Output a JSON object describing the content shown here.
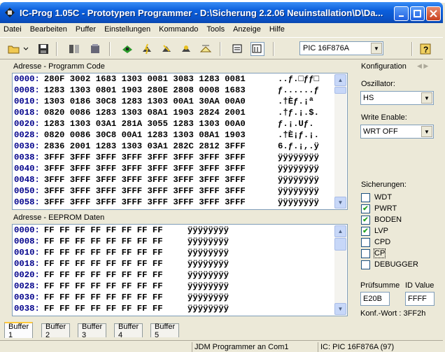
{
  "window": {
    "title": "IC-Prog 1.05C - Prototypen Programmer - D:\\Sicherung 2.2.06 Neuinstallation\\D\\Da..."
  },
  "menu": [
    "Datei",
    "Bearbeiten",
    "Puffer",
    "Einstellungen",
    "Kommando",
    "Tools",
    "Anzeige",
    "Hilfe"
  ],
  "toolbar": {
    "device": "PIC 16F876A"
  },
  "program": {
    "label": "Adresse - Programm Code",
    "rows": [
      {
        "addr": "0000:",
        "data": "280F 3002 1683 1303 0081 3083 1283 0081",
        "ascii": "..ƒ.□ƒƒ□"
      },
      {
        "addr": "0008:",
        "data": "1283 1303 0801 1903 280E 2808 0008 1683",
        "ascii": "ƒ......ƒ"
      },
      {
        "addr": "0010:",
        "data": "1303 0186 30C8 1283 1303 00A1 30AA 00A0",
        "ascii": ".†Èƒ.¡ª "
      },
      {
        "addr": "0018:",
        "data": "0820 0086 1283 1303 08A1 1903 2824 2001",
        "ascii": ".†ƒ.¡.$."
      },
      {
        "addr": "0020:",
        "data": "1283 1303 03A1 281A 3055 1283 1303 00A0",
        "ascii": "ƒ.¡.Uƒ. "
      },
      {
        "addr": "0028:",
        "data": "0820 0086 30C8 00A1 1283 1303 08A1 1903",
        "ascii": ".†È¡ƒ.¡."
      },
      {
        "addr": "0030:",
        "data": "2836 2001 1283 1303 03A1 282C 2812 3FFF",
        "ascii": "6.ƒ.¡,.ÿ"
      },
      {
        "addr": "0038:",
        "data": "3FFF 3FFF 3FFF 3FFF 3FFF 3FFF 3FFF 3FFF",
        "ascii": "ÿÿÿÿÿÿÿÿ"
      },
      {
        "addr": "0040:",
        "data": "3FFF 3FFF 3FFF 3FFF 3FFF 3FFF 3FFF 3FFF",
        "ascii": "ÿÿÿÿÿÿÿÿ"
      },
      {
        "addr": "0048:",
        "data": "3FFF 3FFF 3FFF 3FFF 3FFF 3FFF 3FFF 3FFF",
        "ascii": "ÿÿÿÿÿÿÿÿ"
      },
      {
        "addr": "0050:",
        "data": "3FFF 3FFF 3FFF 3FFF 3FFF 3FFF 3FFF 3FFF",
        "ascii": "ÿÿÿÿÿÿÿÿ"
      },
      {
        "addr": "0058:",
        "data": "3FFF 3FFF 3FFF 3FFF 3FFF 3FFF 3FFF 3FFF",
        "ascii": "ÿÿÿÿÿÿÿÿ"
      }
    ]
  },
  "eeprom": {
    "label": "Adresse - EEPROM Daten",
    "rows": [
      {
        "addr": "0000:",
        "data": "FF FF FF FF FF FF FF FF",
        "ascii": "ÿÿÿÿÿÿÿÿ"
      },
      {
        "addr": "0008:",
        "data": "FF FF FF FF FF FF FF FF",
        "ascii": "ÿÿÿÿÿÿÿÿ"
      },
      {
        "addr": "0010:",
        "data": "FF FF FF FF FF FF FF FF",
        "ascii": "ÿÿÿÿÿÿÿÿ"
      },
      {
        "addr": "0018:",
        "data": "FF FF FF FF FF FF FF FF",
        "ascii": "ÿÿÿÿÿÿÿÿ"
      },
      {
        "addr": "0020:",
        "data": "FF FF FF FF FF FF FF FF",
        "ascii": "ÿÿÿÿÿÿÿÿ"
      },
      {
        "addr": "0028:",
        "data": "FF FF FF FF FF FF FF FF",
        "ascii": "ÿÿÿÿÿÿÿÿ"
      },
      {
        "addr": "0030:",
        "data": "FF FF FF FF FF FF FF FF",
        "ascii": "ÿÿÿÿÿÿÿÿ"
      },
      {
        "addr": "0038:",
        "data": "FF FF FF FF FF FF FF FF",
        "ascii": "ÿÿÿÿÿÿÿÿ"
      }
    ]
  },
  "config": {
    "label": "Konfiguration",
    "osc_label": "Oszillator:",
    "osc_value": "HS",
    "we_label": "Write Enable:",
    "we_value": "WRT OFF",
    "fuses_label": "Sicherungen:",
    "fuses": [
      {
        "name": "WDT",
        "checked": false
      },
      {
        "name": "PWRT",
        "checked": true
      },
      {
        "name": "BODEN",
        "checked": true
      },
      {
        "name": "LVP",
        "checked": true
      },
      {
        "name": "CPD",
        "checked": false
      },
      {
        "name": "CP",
        "checked": false
      },
      {
        "name": "DEBUGGER",
        "checked": false
      }
    ],
    "checksum_label": "Prüfsumme",
    "checksum_value": "E20B",
    "id_label": "ID Value",
    "id_value": "FFFF",
    "config_word": "Konf.-Wort : 3FF2h"
  },
  "tabs": [
    "Buffer 1",
    "Buffer 2",
    "Buffer 3",
    "Buffer 4",
    "Buffer 5"
  ],
  "status": {
    "programmer": "JDM Programmer an Com1",
    "device": "IC: PIC 16F876A  (97)"
  }
}
